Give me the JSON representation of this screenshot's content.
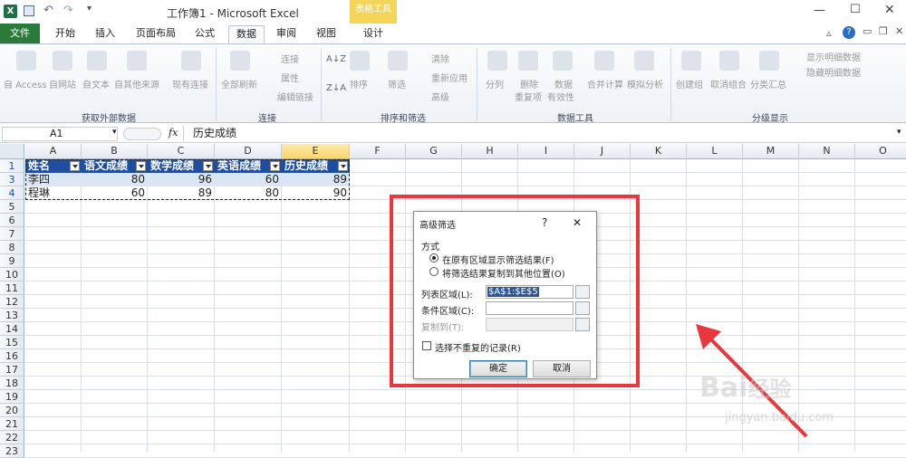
{
  "window": {
    "title": "工作簿1 - Microsoft Excel",
    "context_tab_group": "表格工具"
  },
  "tabs": [
    {
      "label": "文件"
    },
    {
      "label": "开始"
    },
    {
      "label": "插入"
    },
    {
      "label": "页面布局"
    },
    {
      "label": "公式"
    },
    {
      "label": "数据"
    },
    {
      "label": "审阅"
    },
    {
      "label": "视图"
    },
    {
      "label": "设计"
    }
  ],
  "ribbon": {
    "get_external": {
      "items": [
        "自 Access",
        "自网站",
        "自文本",
        "自其他来源",
        "现有连接"
      ],
      "group": "获取外部数据"
    },
    "connections": {
      "refresh_all": "全部刷新",
      "connect": "连接",
      "properties": "属性",
      "edit_links": "编辑链接",
      "group": "连接"
    },
    "sort_filter": {
      "sort": "排序",
      "filter": "筛选",
      "clear": "清除",
      "reapply": "重新应用",
      "advanced": "高级",
      "group": "排序和筛选"
    },
    "data_tools": {
      "split": "分列",
      "remove_dup_1": "删除",
      "remove_dup_2": "重复项",
      "validation_1": "数据",
      "validation_2": "有效性",
      "consolidate": "合并计算",
      "what_if": "模拟分析",
      "group": "数据工具"
    },
    "outline": {
      "group_btn": "创建组",
      "ungroup": "取消组合",
      "subtotal": "分类汇总",
      "show_detail": "显示明细数据",
      "hide_detail": "隐藏明细数据",
      "group": "分级显示"
    }
  },
  "formula_bar": {
    "name_box": "A1",
    "fx": "fx",
    "content": "历史成绩"
  },
  "columns": [
    "A",
    "B",
    "C",
    "D",
    "E",
    "F",
    "G",
    "H",
    "I",
    "J",
    "K",
    "L",
    "M",
    "N",
    "O"
  ],
  "rows": [
    "1",
    "3",
    "4",
    "5",
    "6",
    "7",
    "8",
    "9",
    "10",
    "11",
    "12",
    "13",
    "14",
    "15",
    "16",
    "17",
    "18",
    "19",
    "20",
    "21",
    "22",
    "23"
  ],
  "table": {
    "headers": [
      "姓名",
      "语文成绩",
      "数学成绩",
      "英语成绩",
      "历史成绩"
    ],
    "data": [
      [
        "李四",
        "80",
        "96",
        "60",
        "89"
      ],
      [
        "程琳",
        "60",
        "89",
        "80",
        "90"
      ]
    ]
  },
  "dialog": {
    "title": "高级筛选",
    "help": "?",
    "close": "✕",
    "method_label": "方式",
    "option1": "在原有区域显示筛选结果(F)",
    "option2": "将筛选结果复制到其他位置(O)",
    "list_range_label": "列表区域(L):",
    "list_range_value": "$A$1:$E$5",
    "criteria_label": "条件区域(C):",
    "criteria_value": "",
    "copy_to_label": "复制到(T):",
    "copy_to_value": "",
    "unique_label": "选择不重复的记录(R)",
    "ok": "确定",
    "cancel": "取消"
  },
  "colors": {
    "accent": "#2b579a",
    "table_header": "#1f4ea0",
    "highlight_box": "#e8383d",
    "file_tab": "#2a7a3a"
  }
}
